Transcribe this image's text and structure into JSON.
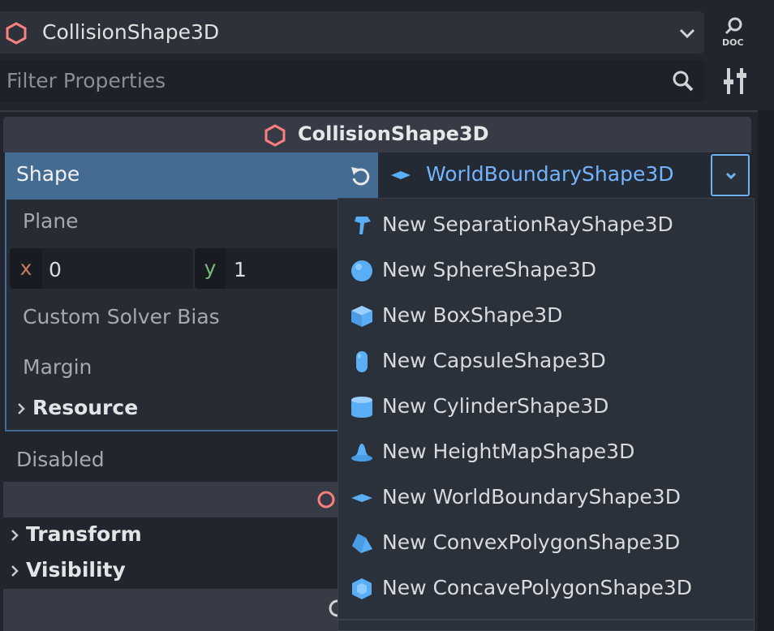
{
  "colors": {
    "accent": "#446b92",
    "link_blue": "#73b4ff",
    "icon_blue": "#5aaef5",
    "node_red": "#fc7f7f"
  },
  "top_bar": {
    "node_name": "CollisionShape3D",
    "node_icon": "collision-shape-icon",
    "doc_icon": "doc-icon"
  },
  "filter": {
    "placeholder": "Filter Properties",
    "search_icon": "search-icon",
    "tools_icon": "tools-icon"
  },
  "section": {
    "title": "CollisionShape3D"
  },
  "shape_property": {
    "label": "Shape",
    "value": "WorldBoundaryShape3D",
    "revert_icon": "revert-icon"
  },
  "plane": {
    "label": "Plane",
    "x_axis": "x",
    "x_value": "0",
    "y_axis": "y",
    "y_value": "1"
  },
  "custom_solver_bias": {
    "label": "Custom Solver Bias"
  },
  "margin": {
    "label": "Margin"
  },
  "resource": {
    "label": "Resource"
  },
  "disabled": {
    "label": "Disabled"
  },
  "node3d_sections": {
    "transform": "Transform",
    "visibility": "Visibility"
  },
  "menu": {
    "items": [
      {
        "label": "New SeparationRayShape3D",
        "icon": "separation-ray-icon"
      },
      {
        "label": "New SphereShape3D",
        "icon": "sphere-icon"
      },
      {
        "label": "New BoxShape3D",
        "icon": "box-icon"
      },
      {
        "label": "New CapsuleShape3D",
        "icon": "capsule-icon"
      },
      {
        "label": "New CylinderShape3D",
        "icon": "cylinder-icon"
      },
      {
        "label": "New HeightMapShape3D",
        "icon": "heightmap-icon"
      },
      {
        "label": "New WorldBoundaryShape3D",
        "icon": "world-boundary-icon"
      },
      {
        "label": "New ConvexPolygonShape3D",
        "icon": "convex-polygon-icon"
      },
      {
        "label": "New ConcavePolygonShape3D",
        "icon": "concave-polygon-icon"
      }
    ]
  }
}
